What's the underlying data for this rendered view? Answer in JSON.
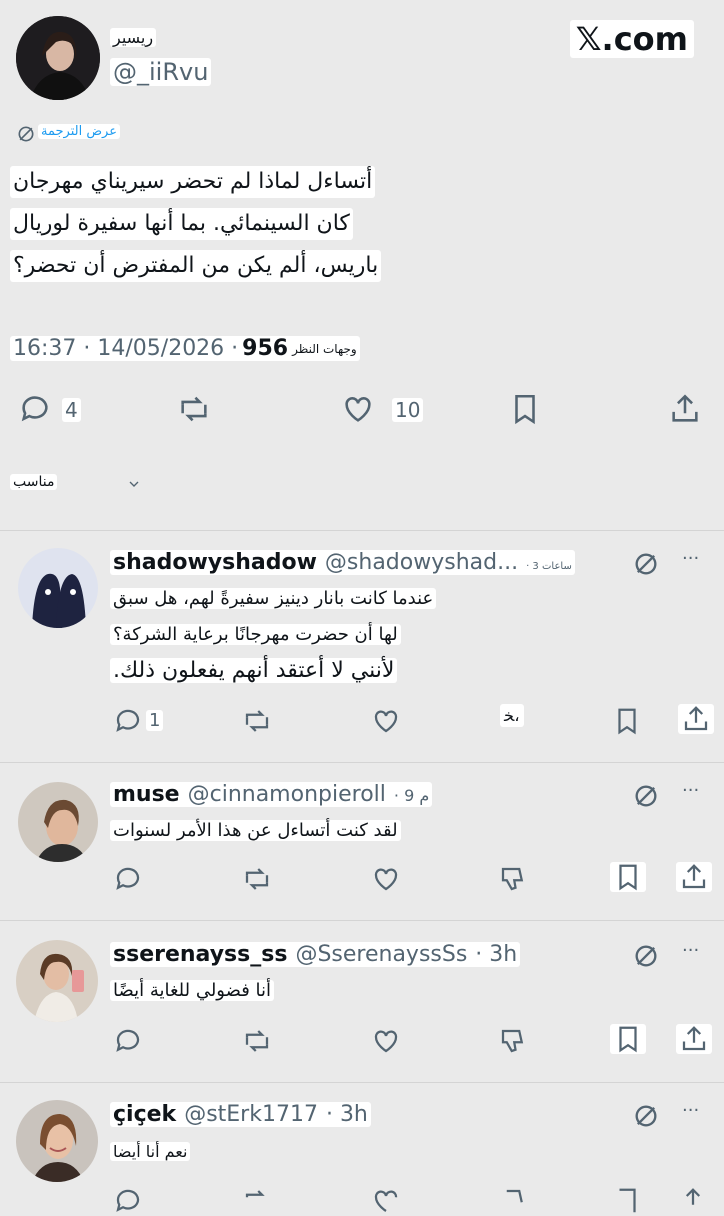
{
  "brand": {
    "logo_text": "𝕏.com"
  },
  "main_tweet": {
    "display_name": "ريسير",
    "handle": "@_iiRvu",
    "translate_label": "عرض الترجمة",
    "text_lines": [
      "أتساءل لماذا لم تحضر سيريناي مهرجان",
      "كان السينمائي. بما أنها سفيرة لوريال",
      "باريس، ألم يكن من المفترض أن تحضر؟"
    ],
    "timestamp": "16:37 · 14/05/2026 ·",
    "views_count": "956",
    "views_label": "وجهات النظر",
    "actions": {
      "replies": "4",
      "likes": "10"
    },
    "sort_label": "مناسب"
  },
  "replies": [
    {
      "name": "shadowyshadow",
      "handle": "@shadowyshad...",
      "time": "· 3 ساعات",
      "text_lines": [
        "عندما كانت بانار دينيز سفيرةً لهم، هل سبق",
        "لها أن حضرت مهرجانًا برعاية الشركة؟",
        "لأنني لا أعتقد أنهم يفعلون ذلك."
      ],
      "reply_count": "1",
      "extra_glyph": "ﺨ،"
    },
    {
      "name": "muse",
      "handle": "@cinnamonpieroll",
      "time": "· 9 م",
      "text_lines": [
        "لقد كنت أتساءل عن هذا الأمر لسنوات"
      ]
    },
    {
      "name": "sserenayss_ss",
      "handle": "@SserenayssSs",
      "time": "· 3h",
      "text_lines": [
        "أنا فضولي للغاية أيضًا"
      ]
    },
    {
      "name": "çiçek",
      "handle": "@stErk1717",
      "time": "· 3h",
      "text_lines": [
        "نعم أنا أيضا"
      ]
    }
  ],
  "colors": {
    "background": "#eaeaea",
    "text": "#0f1419",
    "secondary": "#536471"
  }
}
